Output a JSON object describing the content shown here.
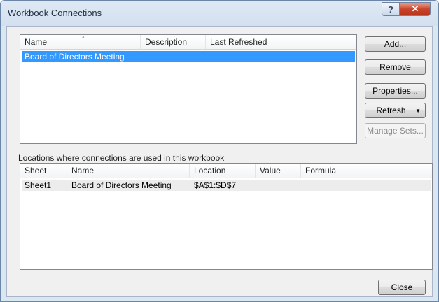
{
  "window": {
    "title": "Workbook Connections",
    "help_glyph": "?",
    "close_glyph": "✕"
  },
  "connections": {
    "columns": [
      "Name",
      "Description",
      "Last Refreshed"
    ],
    "sort_glyph": "^",
    "rows": [
      {
        "name": "Board of Directors Meeting",
        "description": "",
        "last_refreshed": ""
      }
    ]
  },
  "buttons": {
    "add": "Add...",
    "remove": "Remove",
    "properties": "Properties...",
    "refresh": "Refresh",
    "refresh_arrow": "▼",
    "manage_sets": "Manage Sets...",
    "close": "Close"
  },
  "locations": {
    "label": "Locations where connections are used in this workbook",
    "columns": [
      "Sheet",
      "Name",
      "Location",
      "Value",
      "Formula"
    ],
    "rows": [
      {
        "sheet": "Sheet1",
        "name": "Board of Directors Meeting",
        "location": "$A$1:$D$7",
        "value": "",
        "formula": ""
      }
    ]
  },
  "colors": {
    "selection": "#3399ff",
    "close_button": "#c9462c"
  }
}
